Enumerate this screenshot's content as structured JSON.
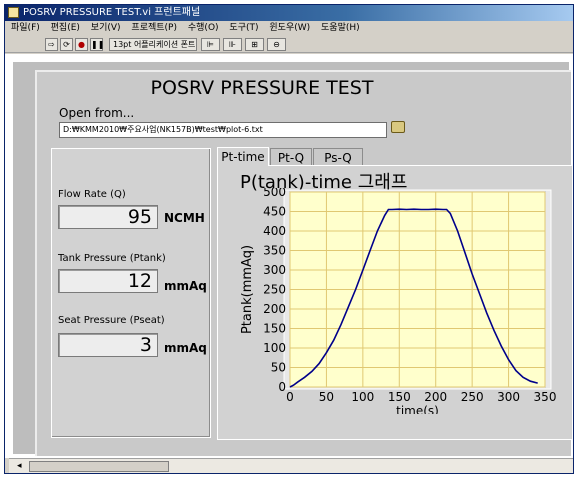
{
  "window": {
    "title": "POSRV PRESSURE TEST.vi 프런트패널"
  },
  "menu": [
    "파일(F)",
    "편집(E)",
    "보기(V)",
    "프로젝트(P)",
    "수행(O)",
    "도구(T)",
    "윈도우(W)",
    "도움말(H)"
  ],
  "toolbar": {
    "font_label": "13pt 어플리케이션 폰트"
  },
  "panel": {
    "title": "POSRV PRESSURE TEST",
    "open_label": "Open from...",
    "path_value": "D:₩KMM2010₩주요사업(NK157B)₩test₩plot-6.txt"
  },
  "indicators": [
    {
      "label": "Flow Rate (Q)",
      "value": "95",
      "unit": "NCMH"
    },
    {
      "label": "Tank Pressure (Ptank)",
      "value": "12",
      "unit": "mmAq"
    },
    {
      "label": "Seat Pressure (Pseat)",
      "value": "3",
      "unit": "mmAq"
    }
  ],
  "tabs": [
    "Pt-time",
    "Pt-Q",
    "Ps-Q"
  ],
  "colors": {
    "plot_bg": "#ffffcc",
    "grid": "#e0c872",
    "trace": "#00008b",
    "panel": "#c9c9c9"
  },
  "chart_data": {
    "type": "line",
    "title": "P(tank)-time 그래프",
    "xlabel": "time(s)",
    "ylabel": "Ptank(mmAq)",
    "xlim": [
      0,
      350
    ],
    "ylim": [
      0,
      500
    ],
    "x_ticks": [
      0,
      50,
      100,
      150,
      200,
      250,
      300,
      350
    ],
    "y_ticks": [
      0,
      50,
      100,
      150,
      200,
      250,
      300,
      350,
      400,
      450,
      500
    ],
    "grid": true,
    "series": [
      {
        "x": [
          0,
          5,
          10,
          20,
          30,
          40,
          50,
          60,
          70,
          80,
          90,
          100,
          110,
          120,
          130,
          135,
          140,
          150,
          160,
          170,
          180,
          190,
          200,
          210,
          215,
          220,
          230,
          240,
          250,
          260,
          270,
          280,
          290,
          300,
          310,
          320,
          330,
          340
        ],
        "y": [
          0,
          5,
          12,
          25,
          40,
          60,
          88,
          120,
          160,
          205,
          250,
          300,
          350,
          400,
          440,
          455,
          455,
          456,
          455,
          456,
          455,
          455,
          456,
          455,
          455,
          445,
          400,
          345,
          290,
          240,
          190,
          145,
          105,
          70,
          42,
          25,
          15,
          10
        ]
      }
    ]
  }
}
